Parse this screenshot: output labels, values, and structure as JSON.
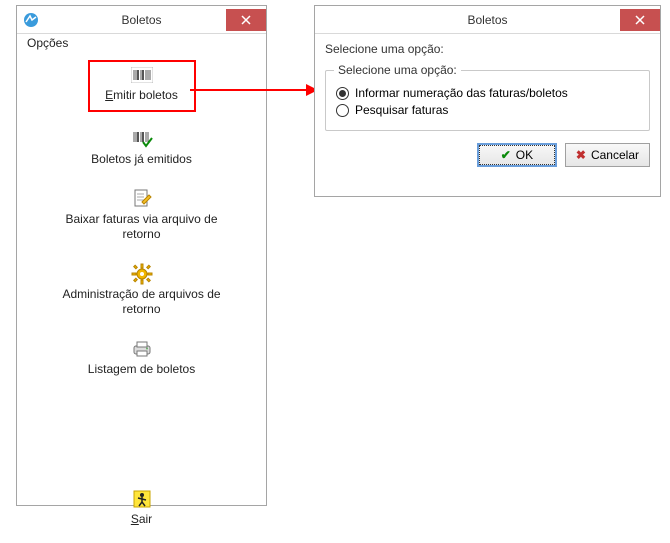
{
  "win1": {
    "title": "Boletos",
    "menu": {
      "opcoes": "Opções"
    },
    "items": [
      {
        "label": "Emitir boletos"
      },
      {
        "label": "Boletos já emitidos"
      },
      {
        "label": "Baixar faturas via arquivo de retorno"
      },
      {
        "label": "Administração de arquivos de retorno"
      },
      {
        "label": "Listagem de boletos"
      },
      {
        "label": "Sair"
      }
    ]
  },
  "win2": {
    "title": "Boletos",
    "prompt": "Selecione uma opção:",
    "group_legend": "Selecione uma opção:",
    "options": [
      {
        "label": "Informar numeração das faturas/boletos",
        "selected": true
      },
      {
        "label": "Pesquisar faturas",
        "selected": false
      }
    ],
    "buttons": {
      "ok": "OK",
      "cancel": "Cancelar"
    }
  }
}
